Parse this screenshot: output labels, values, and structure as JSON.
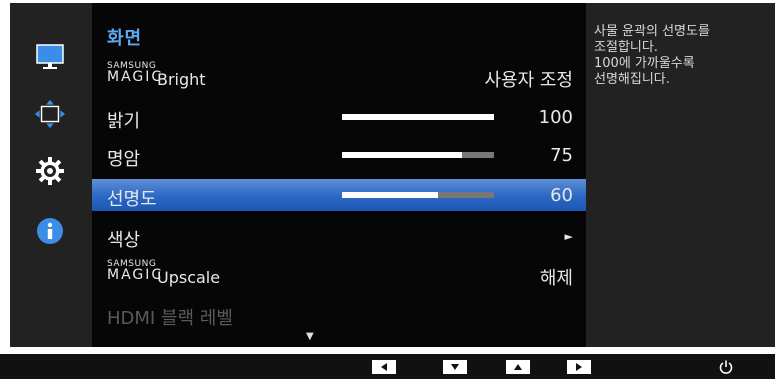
{
  "sidebar": {
    "items": [
      {
        "name": "picture",
        "icon": "monitor-icon"
      },
      {
        "name": "screen-position",
        "icon": "screen-adjust-icon"
      },
      {
        "name": "settings",
        "icon": "gear-icon"
      },
      {
        "name": "information",
        "icon": "info-icon"
      }
    ]
  },
  "menu": {
    "title": "화면",
    "rows": [
      {
        "label_top": "SAMSUNG",
        "label_brand": "MAGIC",
        "label_feature": "Bright",
        "value": "사용자 조정"
      },
      {
        "label": "밝기",
        "value": "100",
        "level": 1.0
      },
      {
        "label": "명암",
        "value": "75",
        "level": 0.79
      },
      {
        "label": "선명도",
        "value": "60",
        "level": 0.63
      },
      {
        "label": "색상",
        "value": "►"
      },
      {
        "label_top": "SAMSUNG",
        "label_brand": "MAGIC",
        "label_feature": "Upscale",
        "value": "해제"
      },
      {
        "label": "HDMI 블랙 레벨"
      }
    ],
    "scroll_indicator": "▼"
  },
  "help": {
    "lines": [
      "사물 윤곽의 선명도를",
      "조절합니다.",
      "100에 가까울수록",
      "선명해집니다."
    ]
  },
  "bottom_bar": {
    "buttons": [
      {
        "name": "left",
        "icon": "arrow-left-icon",
        "glyph": "◀"
      },
      {
        "name": "down",
        "icon": "arrow-down-icon",
        "glyph": "▼"
      },
      {
        "name": "up",
        "icon": "arrow-up-icon",
        "glyph": "▲"
      },
      {
        "name": "right",
        "icon": "arrow-right-icon",
        "glyph": "▶"
      }
    ],
    "power": {
      "icon": "power-icon"
    }
  },
  "colors": {
    "title_accent": "#5ea8f0",
    "selected_row": "#2b67c4",
    "bar_fill": "#ffffff",
    "bar_track": "#777777",
    "disabled_text": "#5a5a5a"
  }
}
